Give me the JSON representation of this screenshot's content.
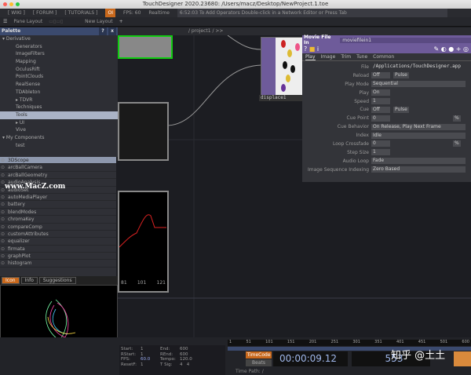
{
  "window": {
    "title": "TouchDesigner 2020.23680: /Users/macz/Desktop/NewProject.1.toe"
  },
  "toolbar": {
    "wiki": "[ WIKI ]",
    "forum": "[ FORUM ]",
    "tutorials": "[ TUTORIALS ]",
    "oi": "OI",
    "fps": "FPS:  60",
    "realtime": "Realtime",
    "status": "6:52:03 To Add Operators Double-click in a Network Editor or Press Tab"
  },
  "panebar": {
    "pane_layout": "Pane Layout",
    "new_layout": "New Layout",
    "plus": "+"
  },
  "palette": {
    "title": "Palette",
    "help": "?",
    "close": "x",
    "tree": [
      {
        "label": "▾ Derivative",
        "level": 0
      },
      {
        "label": "Generators"
      },
      {
        "label": "ImageFilters"
      },
      {
        "label": "Mapping"
      },
      {
        "label": "OculusRift"
      },
      {
        "label": "PointClouds"
      },
      {
        "label": "RealSense"
      },
      {
        "label": "TDAbleton"
      },
      {
        "label": "▸ TDVR"
      },
      {
        "label": "Techniques"
      },
      {
        "label": "Tools",
        "selected": true
      },
      {
        "label": "▸ UI"
      },
      {
        "label": "Vive"
      },
      {
        "label": "▾ My Components",
        "level": 0
      },
      {
        "label": "test"
      }
    ],
    "items": [
      "3DScope",
      "arcBallCamera",
      "arcBallGeometry",
      "audioAnalysis",
      "audioSet",
      "autoMediaPlayer",
      "battery",
      "blendModes",
      "chromaKey",
      "compareComp",
      "customAttributes",
      "equalizer",
      "firmata",
      "graphPlot",
      "histogram"
    ],
    "tabs": [
      "Icon",
      "Info",
      "Suggestions"
    ],
    "watermark": "www.MacZ.com"
  },
  "network": {
    "path": "/ project1 / >>",
    "node_label": "displace1",
    "chart_ticks": [
      "81",
      "101",
      "121"
    ]
  },
  "params": {
    "op_type": "Movie File In",
    "op_name": "moviefilein1",
    "tabs": [
      "Play",
      "Image",
      "Trim",
      "Tune",
      "Common"
    ],
    "rows": [
      {
        "label": "File",
        "value": "/Applications/TouchDesigner.app"
      },
      {
        "label": "Reload",
        "value": "Off",
        "extra": "Pulse"
      },
      {
        "label": "Play Mode",
        "value": "Sequential"
      },
      {
        "label": "Play",
        "value": "On"
      },
      {
        "label": "Speed",
        "value": "1"
      },
      {
        "label": "Cue",
        "value": "Off",
        "extra": "Pulse"
      },
      {
        "label": "Cue Point",
        "value": "0",
        "extra": "%"
      },
      {
        "label": "Cue Behavior",
        "value": "On Release, Play Next Frame"
      },
      {
        "label": "Index",
        "value": "Idle"
      },
      {
        "label": "Loop Crossfade",
        "value": "0",
        "extra": "%"
      },
      {
        "label": "Step Size",
        "value": "1"
      },
      {
        "label": "Audio Loop",
        "value": "Fade"
      },
      {
        "label": "Image Sequence Indexing",
        "value": "Zero Based"
      }
    ]
  },
  "timeline": {
    "start_l": "Start:",
    "start": "1",
    "end_l": "End:",
    "end": "600",
    "rstart_l": "RStart:",
    "rstart": "1",
    "rend_l": "REnd:",
    "rend": "600",
    "fps_l": "FPS:",
    "fps": "60.0",
    "tempo_l": "Tempo:",
    "tempo": "120.0",
    "resetf_l": "ResetF:",
    "resetf": "1",
    "tsig_l": "T Sig:",
    "tsig1": "4",
    "tsig2": "4",
    "ruler": [
      "1",
      "51",
      "101",
      "151",
      "201",
      "251",
      "301",
      "351",
      "401",
      "451",
      "501",
      "600"
    ],
    "timecode_btn": "TimeCode",
    "beats_btn": "Beats",
    "timecode": "00:00:09.12",
    "frame": "553",
    "time_path": "Time Path: /",
    "watermark": "知乎 @土土"
  }
}
